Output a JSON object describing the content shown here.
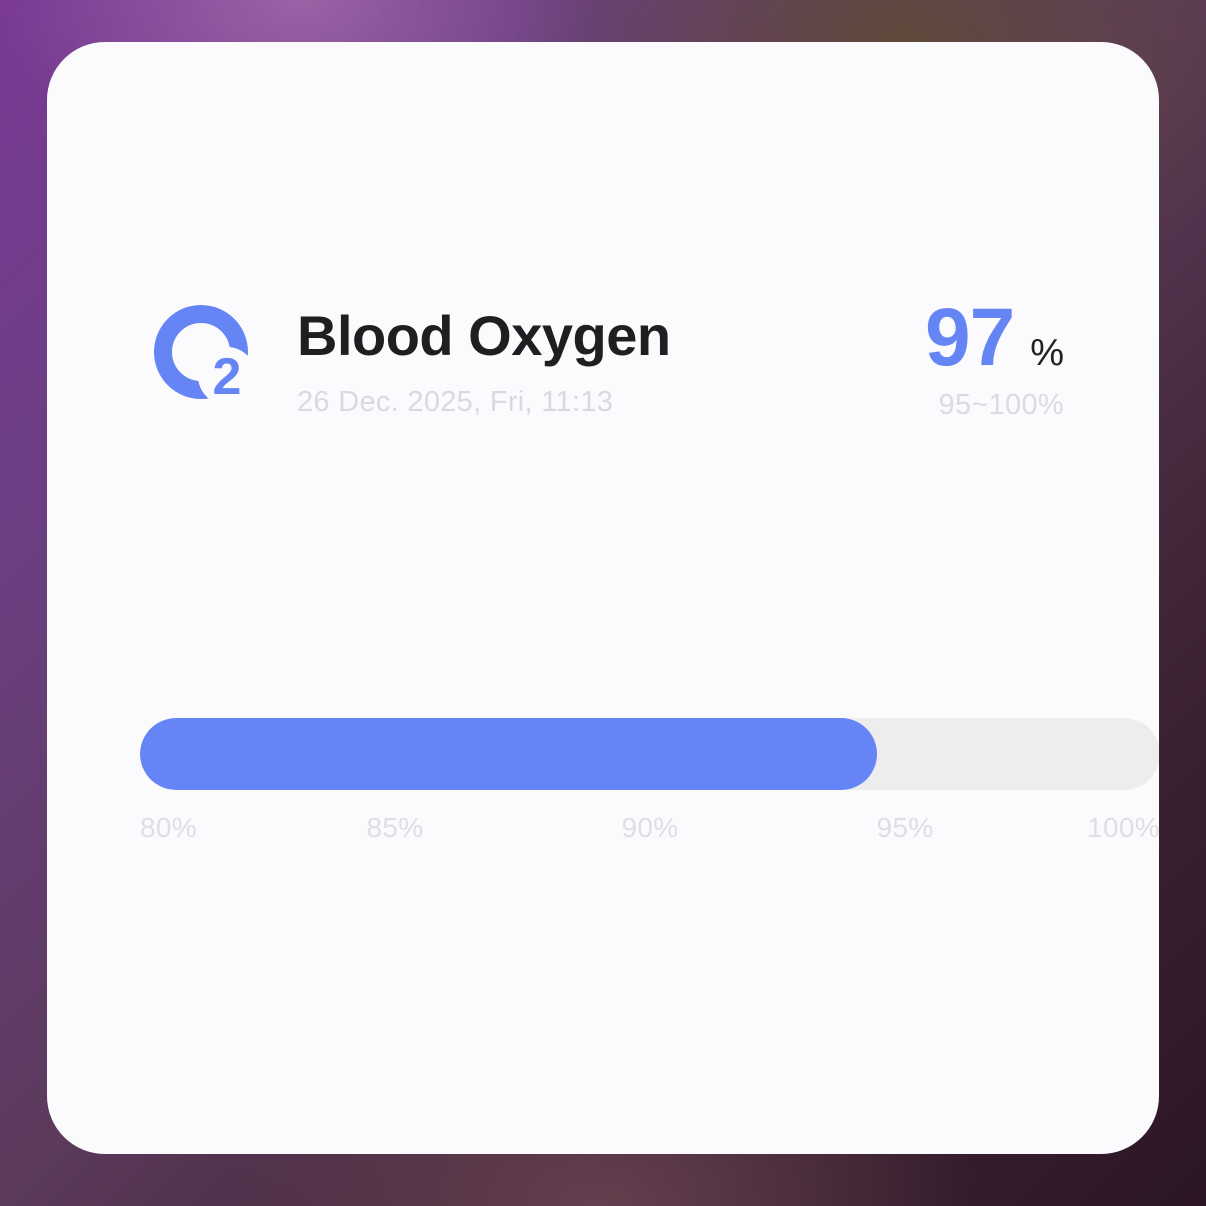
{
  "card": {
    "icon": "o2-icon",
    "title": "Blood Oxygen",
    "timestamp": "26 Dec. 2025, Fri, 11:13",
    "value": "97",
    "unit": "%",
    "normal_range": "95~100%"
  },
  "gauge": {
    "value": 97,
    "min": 80,
    "max": 100,
    "ticks": [
      "80%",
      "85%",
      "90%",
      "95%",
      "100%"
    ],
    "fill_color": "#6585F7",
    "track_color": "#EDEDEE"
  },
  "colors": {
    "accent": "#6585F5",
    "title": "#1F1F22",
    "muted": "#DCDCE0"
  }
}
